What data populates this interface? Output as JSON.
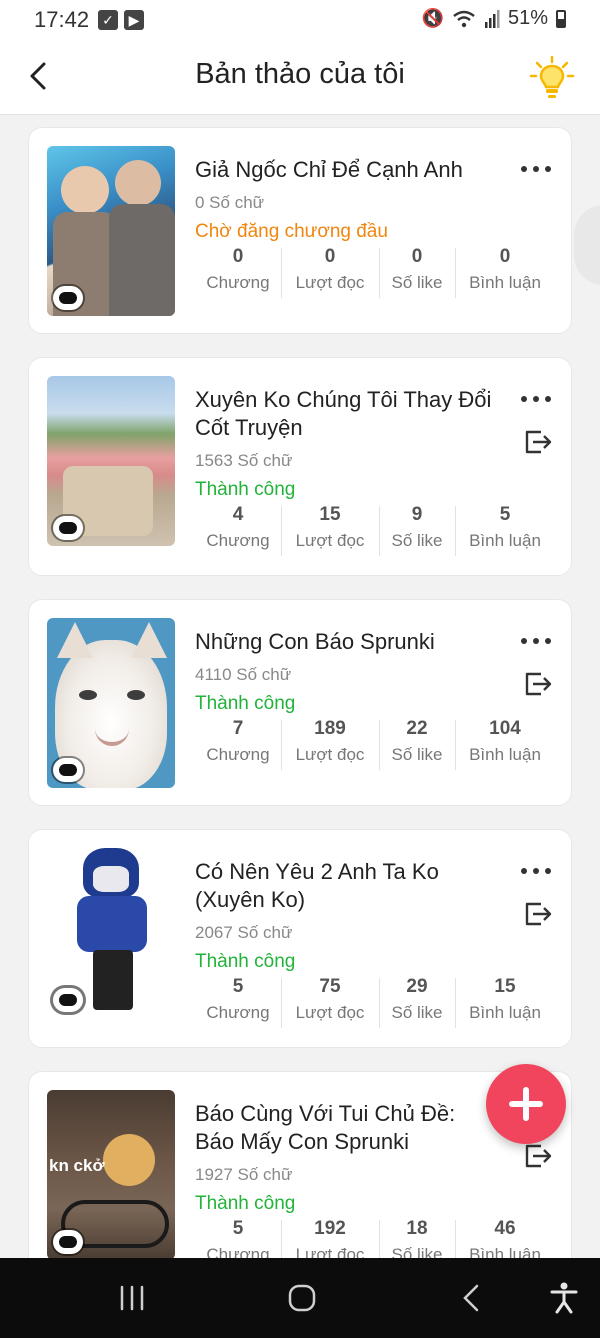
{
  "status_bar": {
    "time": "17:42",
    "battery": "51%"
  },
  "header": {
    "title": "Bản thảo của tôi"
  },
  "stats_labels": {
    "chapters": "Chương",
    "reads": "Lượt đọc",
    "likes": "Số like",
    "comments": "Bình luận"
  },
  "stories": [
    {
      "title": "Giả Ngốc Chỉ Để Cạnh Anh",
      "word_count": "0 Số chữ",
      "status": "Chờ đăng chương đầu",
      "status_color": "#f0860f",
      "chapters": "0",
      "reads": "0",
      "likes": "0",
      "comments": "0"
    },
    {
      "title": "Xuyên Ko Chúng Tôi Thay Đổi Cốt Truyện",
      "word_count": "1563 Số chữ",
      "status": "Thành công",
      "status_color": "#22b33a",
      "chapters": "4",
      "reads": "15",
      "likes": "9",
      "comments": "5"
    },
    {
      "title": "Những Con Báo Sprunki",
      "word_count": "4110 Số chữ",
      "status": "Thành công",
      "status_color": "#22b33a",
      "chapters": "7",
      "reads": "189",
      "likes": "22",
      "comments": "104"
    },
    {
      "title": "Có Nên Yêu 2 Anh Ta Ko (Xuyên Ko)",
      "word_count": "2067 Số chữ",
      "status": "Thành công",
      "status_color": "#22b33a",
      "chapters": "5",
      "reads": "75",
      "likes": "29",
      "comments": "15"
    },
    {
      "title": "Báo Cùng Với Tui Chủ Đề: Báo Mấy Con Sprunki",
      "word_count": "1927 Số chữ",
      "status": "Thành công",
      "status_color": "#22b33a",
      "chapters": "5",
      "reads": "192",
      "likes": "18",
      "comments": "46",
      "cover_text": "kn ckở"
    }
  ],
  "icons": {
    "back": "chevron-left-icon",
    "tips": "lightbulb-icon",
    "more": "more-horizontal-icon",
    "publish": "export-icon",
    "add": "plus-icon"
  }
}
